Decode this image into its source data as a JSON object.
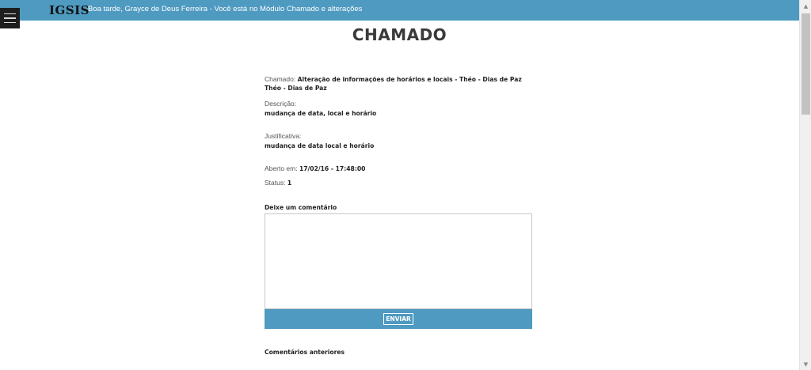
{
  "header": {
    "logo": "IGSIS",
    "greeting": "Boa tarde, Grayce de Deus Ferreira - Você está no Módulo Chamado e alterações",
    "menu_icon": "hamburger-menu-icon",
    "background_color": "#4e9ac0"
  },
  "main": {
    "title": "CHAMADO",
    "chamado": {
      "label": "Chamado:",
      "value_line1": "Alteração de informações de horários e locais - Théo - Dias de Paz",
      "value_line2": "Théo - Dias de Paz"
    },
    "descricao": {
      "label": "Descrição:",
      "value": "mudança de data, local e horário"
    },
    "justificativa": {
      "label": "Justificativa:",
      "value": "mudança de data local e horário"
    },
    "aberto": {
      "label": "Aberto em:",
      "value": "17/02/16 - 17:48:00"
    },
    "status": {
      "label": "Status:",
      "value": "1"
    },
    "comment_form": {
      "label": "Deixe um comentário",
      "textarea_value": "",
      "submit_label": "ENVIAR"
    },
    "previous_comments_label": "Comentários anteriores"
  },
  "scrollbar": {
    "up_icon": "arrow-up-icon",
    "down_icon": "arrow-down-icon"
  }
}
